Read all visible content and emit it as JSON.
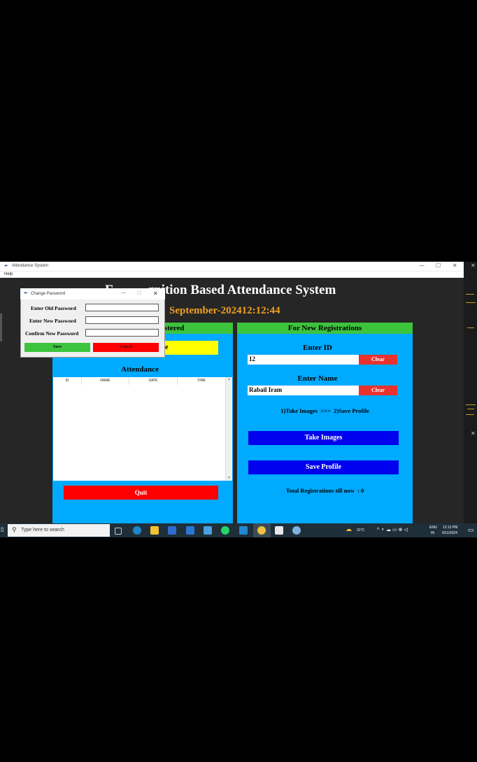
{
  "window": {
    "title": "Attendance System",
    "menu_help": "Help",
    "minimize": "—",
    "maximize": "☐",
    "close": "✕"
  },
  "app": {
    "title_left": "F",
    "title_right": "gnition Based Attendance System",
    "datetime": "September-202412:12:44"
  },
  "registered_panel": {
    "header": "stered",
    "button_label": "e",
    "attendance_label": "Attendance",
    "columns": [
      "ID",
      "NAME",
      "DATE",
      "TIME"
    ],
    "quit_label": "Quit"
  },
  "new_reg_panel": {
    "header": "For New Registrations",
    "enter_id_label": "Enter ID",
    "id_value": "12",
    "clear_label": "Clear",
    "enter_name_label": "Enter Name",
    "name_value": "Rabail Iram",
    "clear_label_2": "Clear",
    "steps_text": "1)Take Images  >>>  2)Save Profile",
    "take_images_label": "Take Images",
    "save_profile_label": "Save Profile",
    "total_text": "Total Registrations till now  : 0"
  },
  "dialog": {
    "title": "Change Password",
    "minimize": "—",
    "maximize": "☐",
    "close": "✕",
    "old_label": "Enter Old Password",
    "new_label": "Enter New Password",
    "confirm_label": "Confirm New Password",
    "old_value": "",
    "new_value": "",
    "confirm_value": "",
    "save_label": "Save",
    "cancel_label": "Cancel"
  },
  "taskbar": {
    "search_placeholder": "Type here to search",
    "weather": "31°C",
    "lang_top": "ENG",
    "lang_bottom": "IN",
    "time": "12:12 PM",
    "date": "9/11/2024"
  },
  "colors": {
    "panel_blue": "#00aaff",
    "header_green": "#3dc43d",
    "datetime_orange": "#f0a020",
    "button_blue": "#0000ee",
    "button_red": "#e8322e",
    "button_yellow": "#ffff00"
  }
}
